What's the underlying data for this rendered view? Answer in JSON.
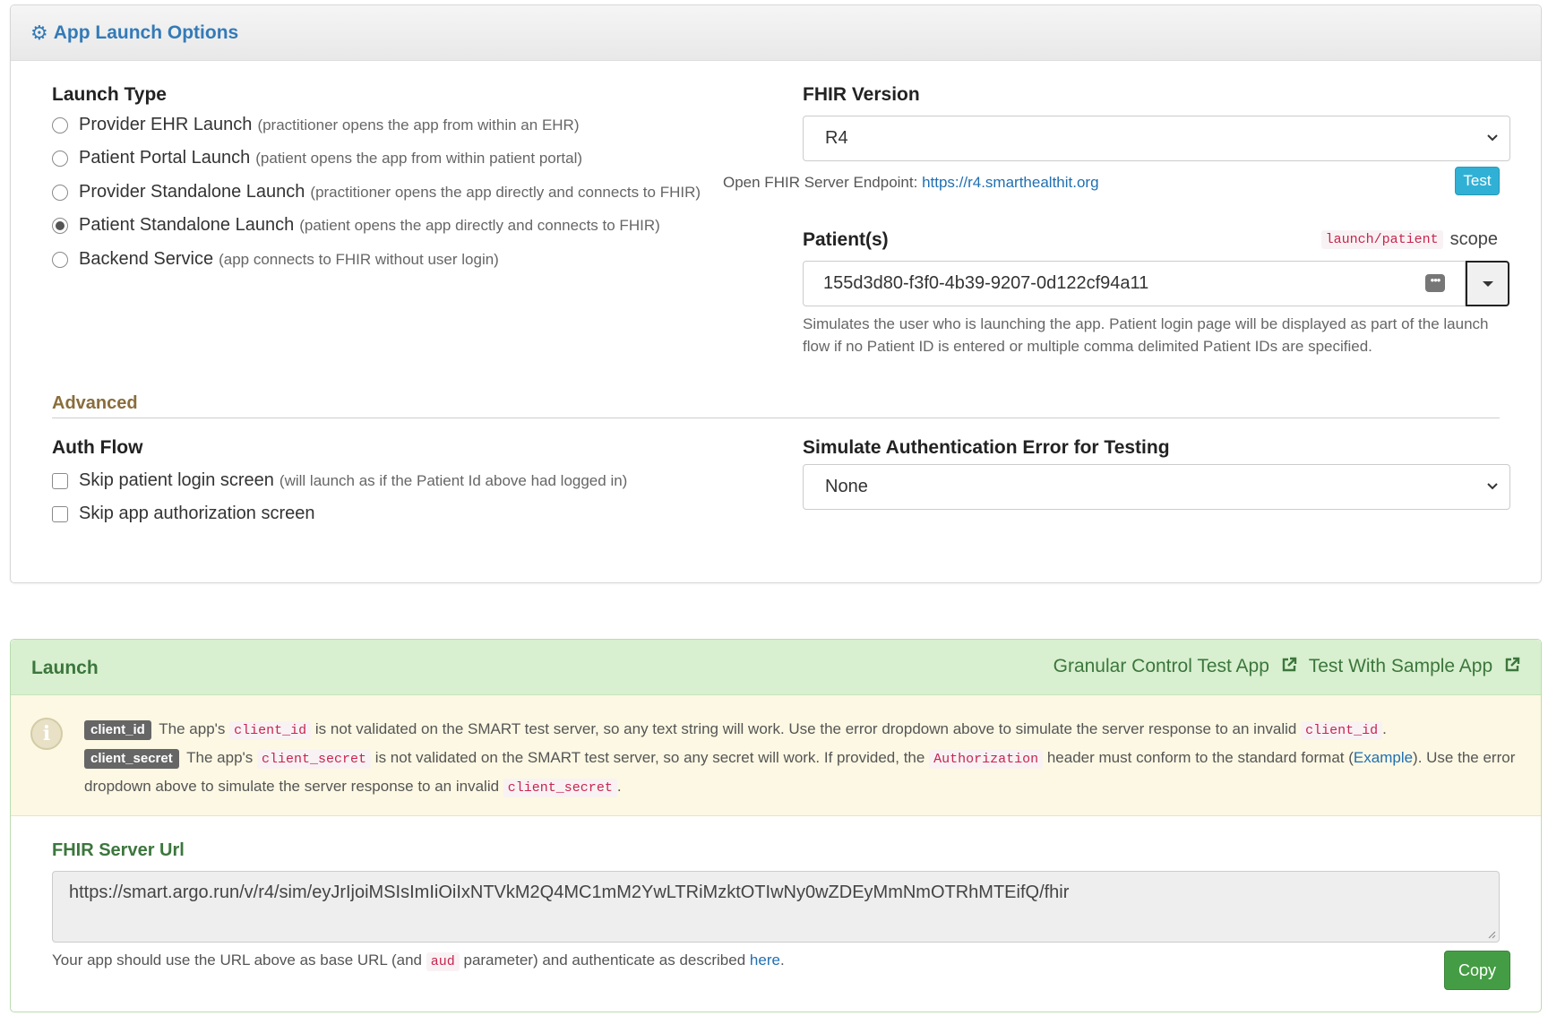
{
  "options_panel": {
    "title": "App Launch Options",
    "launch_type": {
      "label": "Launch Type",
      "options": [
        {
          "label": "Provider EHR Launch",
          "hint": "(practitioner opens the app from within an EHR)",
          "checked": false
        },
        {
          "label": "Patient Portal Launch",
          "hint": "(patient opens the app from within patient portal)",
          "checked": false
        },
        {
          "label": "Provider Standalone Launch",
          "hint": "(practitioner opens the app directly and connects to FHIR)",
          "checked": false
        },
        {
          "label": "Patient Standalone Launch",
          "hint": "(patient opens the app directly and connects to FHIR)",
          "checked": true
        },
        {
          "label": "Backend Service",
          "hint": "(app connects to FHIR without user login)",
          "checked": false
        }
      ]
    },
    "fhir_version": {
      "label": "FHIR Version",
      "selected": "R4",
      "endpoint_prefix": "Open FHIR Server Endpoint:",
      "endpoint_url": "https://r4.smarthealthit.org",
      "test_button": "Test"
    },
    "patients": {
      "label": "Patient(s)",
      "scope_code": "launch/patient",
      "scope_word": "scope",
      "value": "155d3d80-f3f0-4b39-9207-0d122cf94a11",
      "help": "Simulates the user who is launching the app. Patient login page will be displayed as part of the launch flow if no Patient ID is entered or multiple comma delimited Patient IDs are specified."
    },
    "advanced": {
      "label": "Advanced",
      "auth_flow": {
        "label": "Auth Flow",
        "skip_login": {
          "label": "Skip patient login screen",
          "hint": "(will launch as if the Patient Id above had logged in)",
          "checked": false
        },
        "skip_auth": {
          "label": "Skip app authorization screen",
          "checked": false
        }
      },
      "auth_error": {
        "label": "Simulate Authentication Error for Testing",
        "selected": "None"
      }
    }
  },
  "launch_panel": {
    "title": "Launch",
    "links": [
      "Granular Control Test App",
      "Test With Sample App"
    ],
    "info": {
      "client_id_badge": "client_id",
      "client_id_t1": "The app's",
      "client_id_code": "client_id",
      "client_id_t2": "is not validated on the SMART test server, so any text string will work. Use the error dropdown above to simulate the server response to an invalid",
      "client_id_code2": "client_id",
      "client_secret_badge": "client_secret",
      "client_secret_t1": "The app's",
      "client_secret_code": "client_secret",
      "client_secret_t2": "is not validated on the SMART test server, so any secret will work. If provided, the",
      "auth_code": "Authorization",
      "client_secret_t3": "header must conform to the standard format (",
      "example_link": "Example",
      "client_secret_t4": "). Use the error dropdown above to simulate the server response to an invalid",
      "client_secret_code2": "client_secret"
    },
    "fhir_url": {
      "label": "FHIR Server Url",
      "value": "https://smart.argo.run/v/r4/sim/eyJrIjoiMSIsImIiOiIxNTVkM2Q4MC1mM2YwLTRiMzktOTIwNy0wZDEyMmNmOTRhMTEifQ/fhir",
      "help_t1": "Your app should use the URL above as base URL (and",
      "help_code": "aud",
      "help_t2": "parameter) and authenticate as described",
      "help_link": "here",
      "help_t3": ".",
      "copy_button": "Copy"
    }
  },
  "colors": {
    "primary_link": "#337ab7",
    "success_green": "#449d44",
    "info_button": "#31b0d5",
    "warning_bg": "#fcf8e3"
  }
}
